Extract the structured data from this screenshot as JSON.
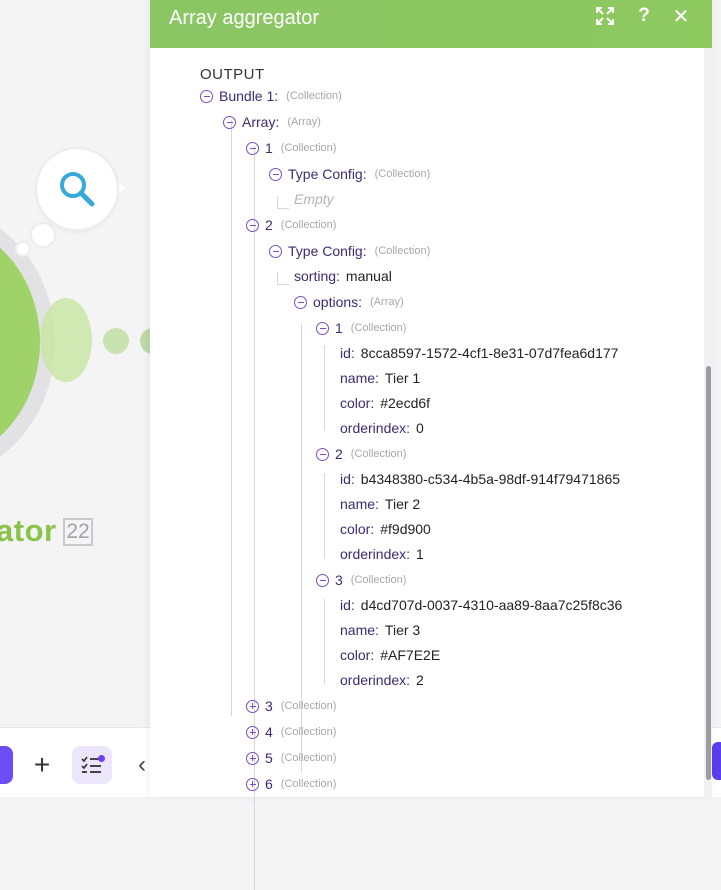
{
  "canvas": {
    "module_name_partial": "ator",
    "module_id": "22",
    "icon": "search-icon",
    "toolbar": {
      "add_icon": "plus-icon",
      "list_icon": "checklist-icon",
      "back_icon": "chevron-left-icon"
    }
  },
  "panel": {
    "title": "Array aggregator",
    "actions": [
      "expand-icon",
      "help-icon",
      "close-icon"
    ],
    "help_label": "?",
    "close_label": "✕",
    "output_label": "OUTPUT",
    "tree": [
      {
        "key": "Bundle 1:",
        "value": "",
        "type": "(Collection)",
        "state": "expanded"
      },
      {
        "key": "Array:",
        "value": "",
        "type": "(Array)",
        "state": "expanded"
      },
      {
        "key": "1",
        "value": "",
        "type": "(Collection)",
        "state": "expanded"
      },
      {
        "key": "Type Config:",
        "value": "",
        "type": "(Collection)",
        "state": "expanded"
      },
      {
        "key": "",
        "value": "Empty",
        "type": "",
        "state": "empty"
      },
      {
        "key": "2",
        "value": "",
        "type": "(Collection)",
        "state": "expanded"
      },
      {
        "key": "Type Config:",
        "value": "",
        "type": "(Collection)",
        "state": "expanded"
      },
      {
        "key": "sorting:",
        "value": "manual",
        "type": "",
        "state": "leaf"
      },
      {
        "key": "options:",
        "value": "",
        "type": "(Array)",
        "state": "expanded"
      },
      {
        "key": "1",
        "value": "",
        "type": "(Collection)",
        "state": "expanded"
      },
      {
        "key": "id:",
        "value": "8cca8597-1572-4cf1-8e31-07d7fea6d177",
        "type": "",
        "state": "leaf"
      },
      {
        "key": "name:",
        "value": "Tier 1",
        "type": "",
        "state": "leaf"
      },
      {
        "key": "color:",
        "value": "#2ecd6f",
        "type": "",
        "state": "leaf"
      },
      {
        "key": "orderindex:",
        "value": "0",
        "type": "",
        "state": "leaf"
      },
      {
        "key": "2",
        "value": "",
        "type": "(Collection)",
        "state": "expanded"
      },
      {
        "key": "id:",
        "value": "b4348380-c534-4b5a-98df-914f79471865",
        "type": "",
        "state": "leaf"
      },
      {
        "key": "name:",
        "value": "Tier 2",
        "type": "",
        "state": "leaf"
      },
      {
        "key": "color:",
        "value": "#f9d900",
        "type": "",
        "state": "leaf"
      },
      {
        "key": "orderindex:",
        "value": "1",
        "type": "",
        "state": "leaf"
      },
      {
        "key": "3",
        "value": "",
        "type": "(Collection)",
        "state": "expanded"
      },
      {
        "key": "id:",
        "value": "d4cd707d-0037-4310-aa89-8aa7c25f8c36",
        "type": "",
        "state": "leaf"
      },
      {
        "key": "name:",
        "value": "Tier 3",
        "type": "",
        "state": "leaf"
      },
      {
        "key": "color:",
        "value": "#AF7E2E",
        "type": "",
        "state": "leaf"
      },
      {
        "key": "orderindex:",
        "value": "2",
        "type": "",
        "state": "leaf"
      },
      {
        "key": "3",
        "value": "",
        "type": "(Collection)",
        "state": "collapsed"
      },
      {
        "key": "4",
        "value": "",
        "type": "(Collection)",
        "state": "collapsed"
      },
      {
        "key": "5",
        "value": "",
        "type": "(Collection)",
        "state": "collapsed"
      },
      {
        "key": "6",
        "value": "",
        "type": "(Collection)",
        "state": "collapsed"
      }
    ]
  },
  "colors": {
    "header_green": "#8bc665",
    "toggle_purple": "#7a4fc0",
    "key_text": "#3d2b72",
    "module_green": "#8bc34a",
    "accent_purple": "#6d4cf5"
  }
}
